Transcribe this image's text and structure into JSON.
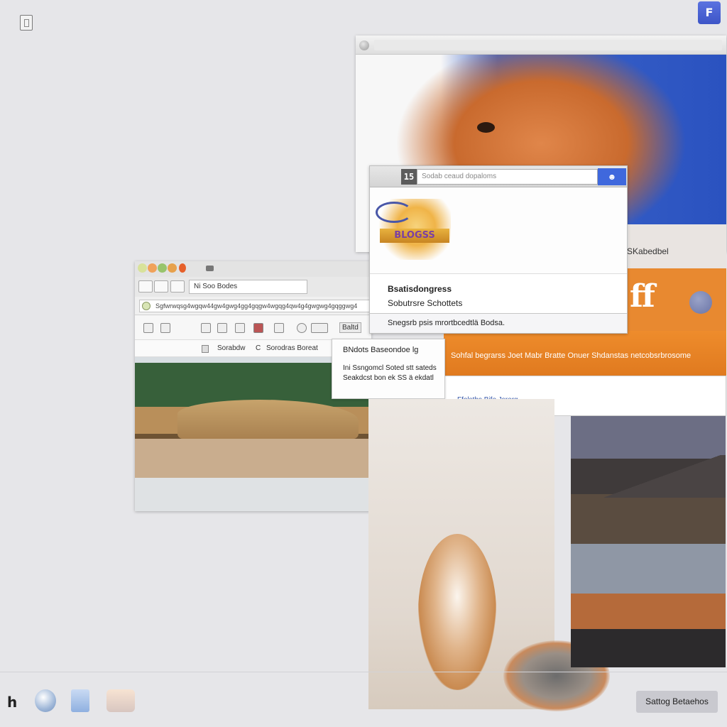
{
  "top_right_badge": "F",
  "left_browser": {
    "search_field": "Ni Soo Bodes",
    "address_text": "Sgfwrwqsg4wgqw44gw4gwg4gg4gqgw4wgqg4qw4g4gwgwg4gqggwg4",
    "toolbar_label": "Baltd",
    "filter_left": "Sorabdw",
    "filter_mid": "C",
    "filter_right": "Sorodras Boreat"
  },
  "dialog": {
    "tag": "15",
    "field_text": "Sodab ceaud dopaloms",
    "logo_text": "BLOGSS",
    "line1": "Bsatisdongress",
    "line2": "Sobutrsre Schottets",
    "line3": "Snegsrb psis mrortbcedtlä Bodsa."
  },
  "popover": {
    "title": "BNdots Baseondoe lg",
    "body": "Ini Ssngomcl Soted stt sateds Seakdcst bon ek SS ä ekdatl"
  },
  "orange_panel": {
    "label": "SKabedbel",
    "hero_text": "ff",
    "band_text": "Sohfal begrarss Joet Mabr Bratte Onuer Shdanstas netcobsrbrosome",
    "link_text": "Ffolsths Bife Jsrorg"
  },
  "dock": {
    "glyph": "h",
    "button_label": "Sattog Betaehos"
  }
}
